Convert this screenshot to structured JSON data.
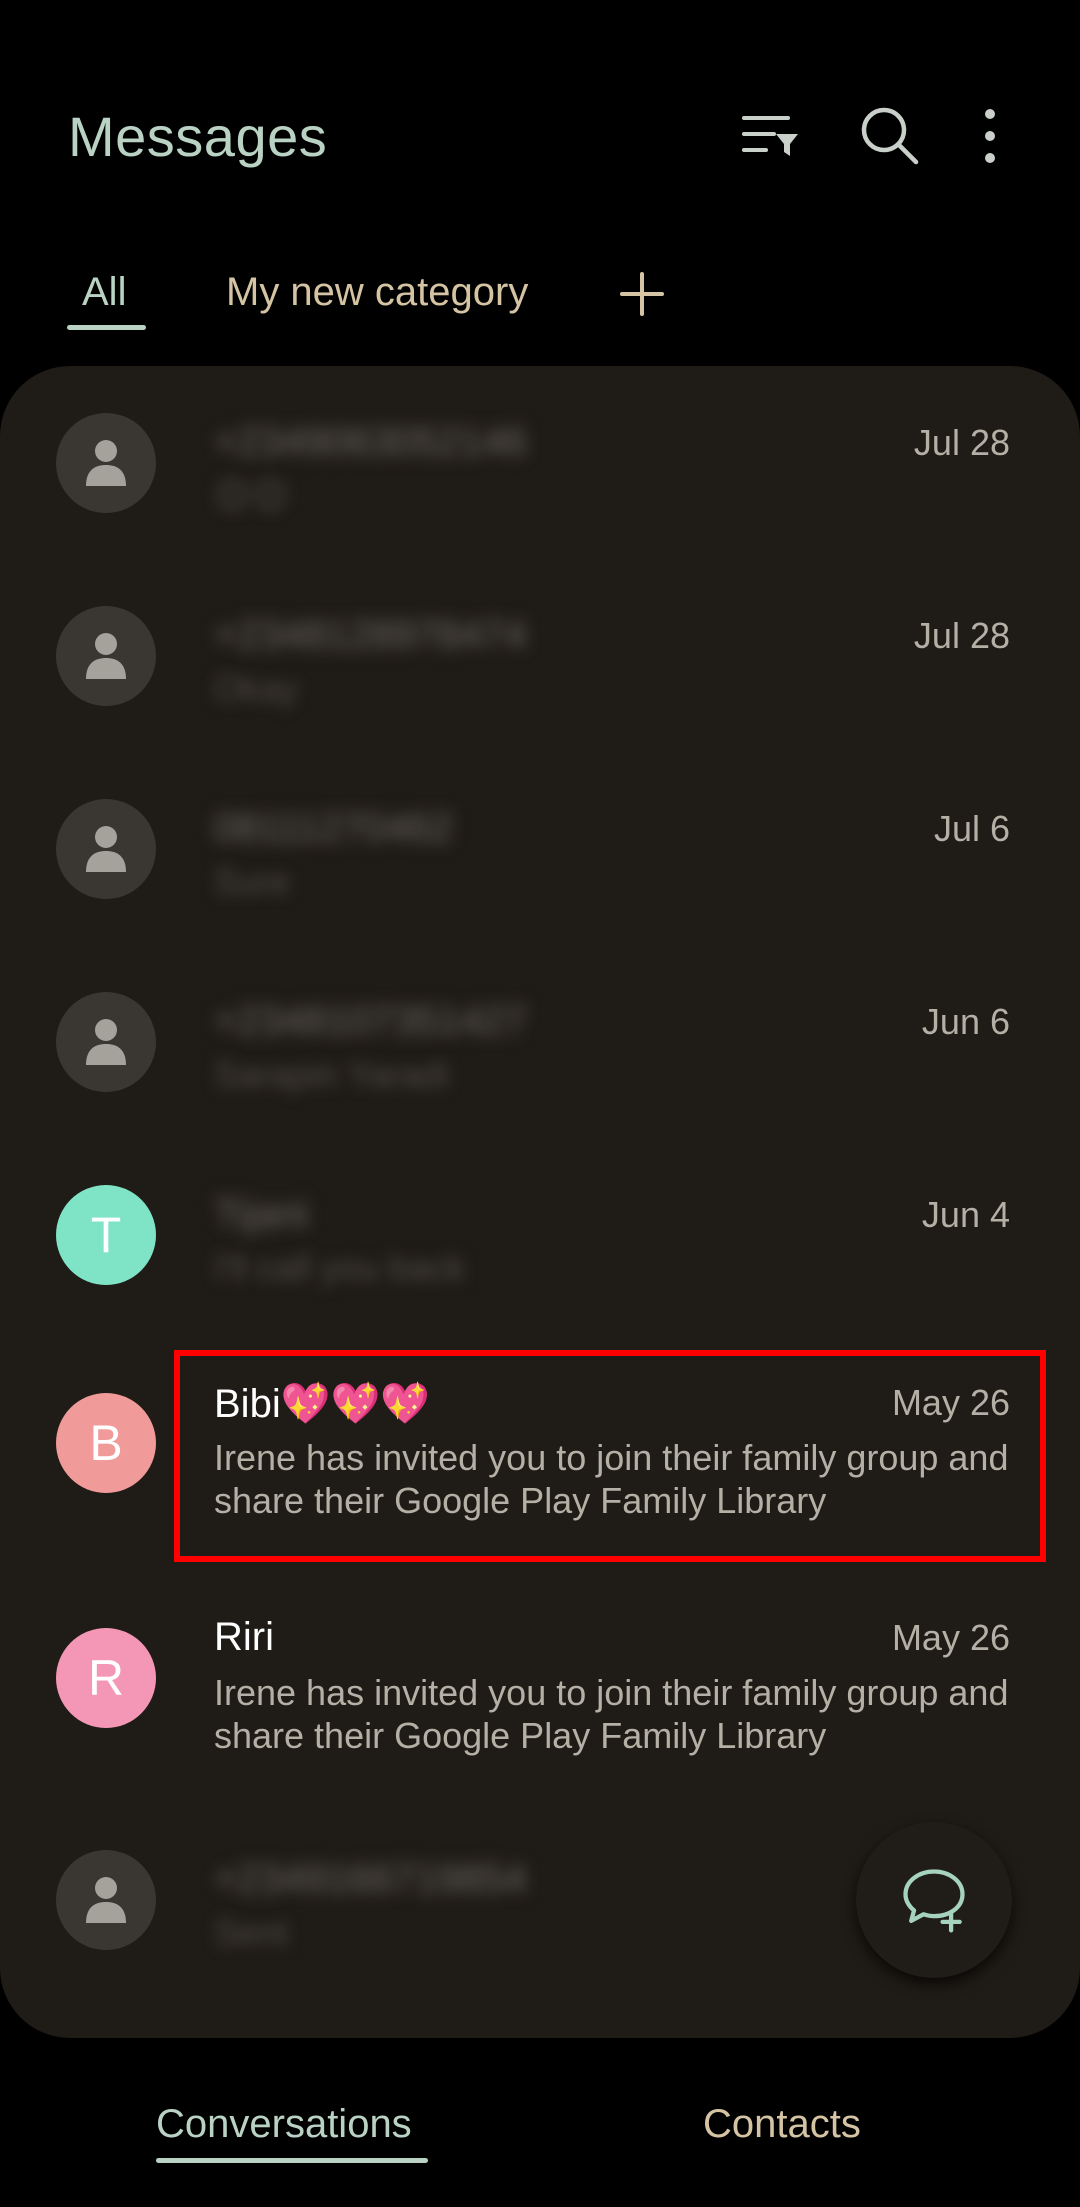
{
  "header": {
    "title": "Messages"
  },
  "tabs": [
    {
      "label": "All",
      "active": true
    },
    {
      "label": "My new category",
      "active": false
    }
  ],
  "conversations": [
    {
      "name": "+2349063052146",
      "date": "Jul 28",
      "preview": "😊😊",
      "avatar": "person-icon",
      "blurred": true
    },
    {
      "name": "+2348128978474",
      "date": "Jul 28",
      "preview": "Okay",
      "avatar": "person-icon",
      "blurred": true
    },
    {
      "name": "08111270462",
      "date": "Jul 6",
      "preview": "Sure",
      "avatar": "person-icon",
      "blurred": true
    },
    {
      "name": "+2348107351427",
      "date": "Jun 6",
      "preview": "Sarapin Yaradi",
      "avatar": "person-icon",
      "blurred": true
    },
    {
      "name": "Tijani",
      "date": "Jun 4",
      "preview": "I'll call you back",
      "avatar": "T",
      "avatar_color": "#7fe3c6",
      "blurred": true
    },
    {
      "name": "Bibi💖💖💖",
      "date": "May 26",
      "preview": "Irene has invited you to join their family group and share their Google Play Family Library",
      "avatar": "B",
      "avatar_color": "#f19a9a",
      "blurred": false
    },
    {
      "name": "Riri",
      "date": "May 26",
      "preview": "Irene has invited you to join their family group and share their Google Play Family Library",
      "avatar": "R",
      "avatar_color": "#f497b6",
      "blurred": false
    },
    {
      "name": "+2349166719854",
      "date": "",
      "preview": "Sent",
      "avatar": "person-icon",
      "blurred": true
    }
  ],
  "bottom_nav": {
    "conversations_label": "Conversations",
    "contacts_label": "Contacts"
  },
  "colors": {
    "accent": "#b9d2c4",
    "background": "#000000",
    "panel": "#1f1b16",
    "highlight": "#ff0000"
  }
}
